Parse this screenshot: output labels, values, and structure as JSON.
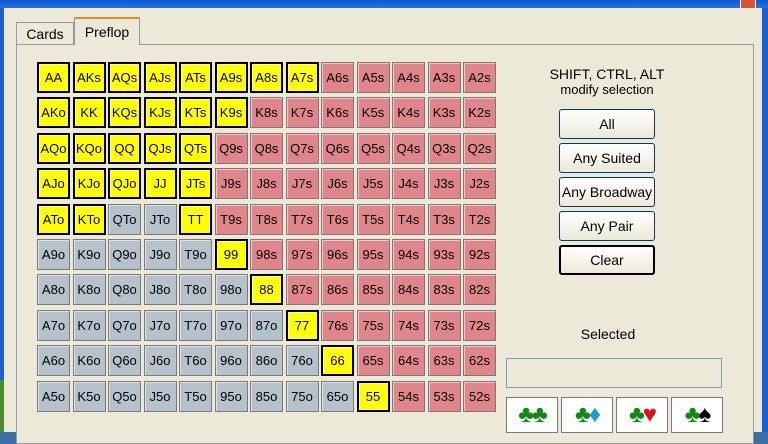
{
  "tabs": [
    {
      "label": "Cards",
      "active": false
    },
    {
      "label": "Preflop",
      "active": true
    }
  ],
  "hint": {
    "line1": "SHIFT, CTRL, ALT",
    "line2": "modify selection"
  },
  "buttons": {
    "all": "All",
    "any_suited": "Any Suited",
    "any_broadway": "Any Broadway",
    "any_pair": "Any Pair",
    "clear": "Clear"
  },
  "selected_label": "Selected",
  "selected_value": "",
  "colors": {
    "selected": "#ffff00",
    "suited": "#e0868a",
    "offsuit": "#b5c2cb"
  },
  "grid_rows": [
    [
      "AA",
      "AKs",
      "AQs",
      "AJs",
      "ATs",
      "A9s",
      "A8s",
      "A7s",
      "A6s",
      "A5s",
      "A4s",
      "A3s",
      "A2s"
    ],
    [
      "AKo",
      "KK",
      "KQs",
      "KJs",
      "KTs",
      "K9s",
      "K8s",
      "K7s",
      "K6s",
      "K5s",
      "K4s",
      "K3s",
      "K2s"
    ],
    [
      "AQo",
      "KQo",
      "QQ",
      "QJs",
      "QTs",
      "Q9s",
      "Q8s",
      "Q7s",
      "Q6s",
      "Q5s",
      "Q4s",
      "Q3s",
      "Q2s"
    ],
    [
      "AJo",
      "KJo",
      "QJo",
      "JJ",
      "JTs",
      "J9s",
      "J8s",
      "J7s",
      "J6s",
      "J5s",
      "J4s",
      "J3s",
      "J2s"
    ],
    [
      "ATo",
      "KTo",
      "QTo",
      "JTo",
      "TT",
      "T9s",
      "T8s",
      "T7s",
      "T6s",
      "T5s",
      "T4s",
      "T3s",
      "T2s"
    ],
    [
      "A9o",
      "K9o",
      "Q9o",
      "J9o",
      "T9o",
      "99",
      "98s",
      "97s",
      "96s",
      "95s",
      "94s",
      "93s",
      "92s"
    ],
    [
      "A8o",
      "K8o",
      "Q8o",
      "J8o",
      "T8o",
      "98o",
      "88",
      "87s",
      "86s",
      "85s",
      "84s",
      "83s",
      "82s"
    ],
    [
      "A7o",
      "K7o",
      "Q7o",
      "J7o",
      "T7o",
      "97o",
      "87o",
      "77",
      "76s",
      "75s",
      "74s",
      "73s",
      "72s"
    ],
    [
      "A6o",
      "K6o",
      "Q6o",
      "J6o",
      "T6o",
      "96o",
      "86o",
      "76o",
      "66",
      "65s",
      "64s",
      "63s",
      "62s"
    ],
    [
      "A5o",
      "K5o",
      "Q5o",
      "J5o",
      "T5o",
      "95o",
      "85o",
      "75o",
      "65o",
      "55",
      "54s",
      "53s",
      "52s"
    ]
  ],
  "selected_hands": [
    "AA",
    "AKs",
    "AQs",
    "AJs",
    "ATs",
    "A9s",
    "A8s",
    "A7s",
    "AKo",
    "KK",
    "KQs",
    "KJs",
    "KTs",
    "K9s",
    "AQo",
    "KQo",
    "QQ",
    "QJs",
    "QTs",
    "AJo",
    "KJo",
    "QJo",
    "JJ",
    "JTs",
    "ATo",
    "KTo",
    "TT",
    "99",
    "88",
    "77",
    "66",
    "55"
  ],
  "suit_filters": [
    {
      "name": "clubs-clubs",
      "icons": [
        "club-icon",
        "club-icon"
      ]
    },
    {
      "name": "clubs-diamonds",
      "icons": [
        "club-icon",
        "diamond-icon"
      ]
    },
    {
      "name": "clubs-hearts",
      "icons": [
        "club-icon",
        "heart-icon"
      ]
    },
    {
      "name": "clubs-spades",
      "icons": [
        "club-icon",
        "spade-icon"
      ]
    }
  ]
}
